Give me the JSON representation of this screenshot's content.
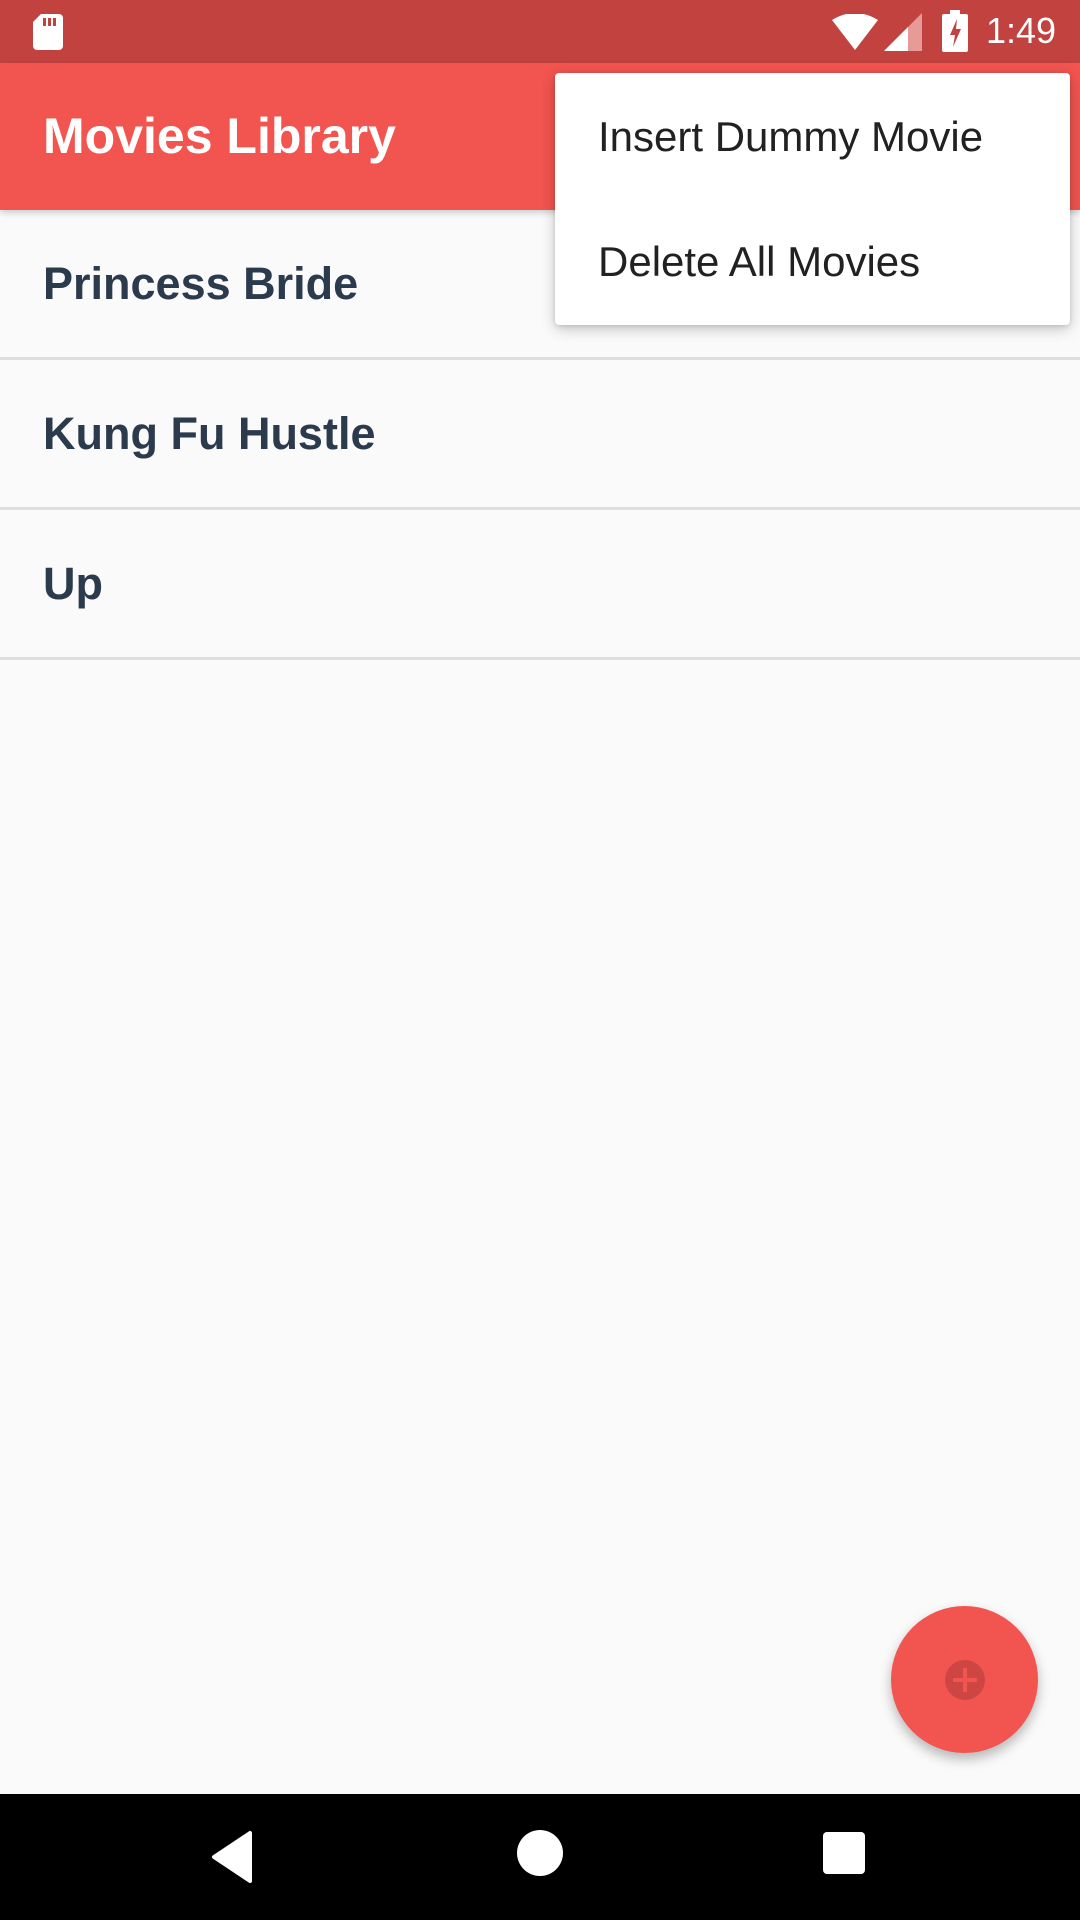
{
  "status_bar": {
    "time": "1:49",
    "icons": [
      "sd-card-icon",
      "wifi-icon",
      "cell-signal-icon",
      "battery-charging-icon"
    ]
  },
  "app_bar": {
    "title": "Movies Library"
  },
  "movies": [
    {
      "title": "Princess Bride"
    },
    {
      "title": "Kung Fu Hustle"
    },
    {
      "title": "Up"
    }
  ],
  "overflow_menu": {
    "items": [
      {
        "label": "Insert Dummy Movie"
      },
      {
        "label": "Delete All Movies"
      }
    ]
  },
  "fab": {
    "icon": "add-icon"
  },
  "nav_bar": {
    "icons": [
      "back-icon",
      "home-icon",
      "recents-icon"
    ]
  },
  "colors": {
    "primary": "#f2544f",
    "primary_dark": "#c2423f",
    "list_text": "#2b3a4d",
    "background": "#fafafa"
  }
}
